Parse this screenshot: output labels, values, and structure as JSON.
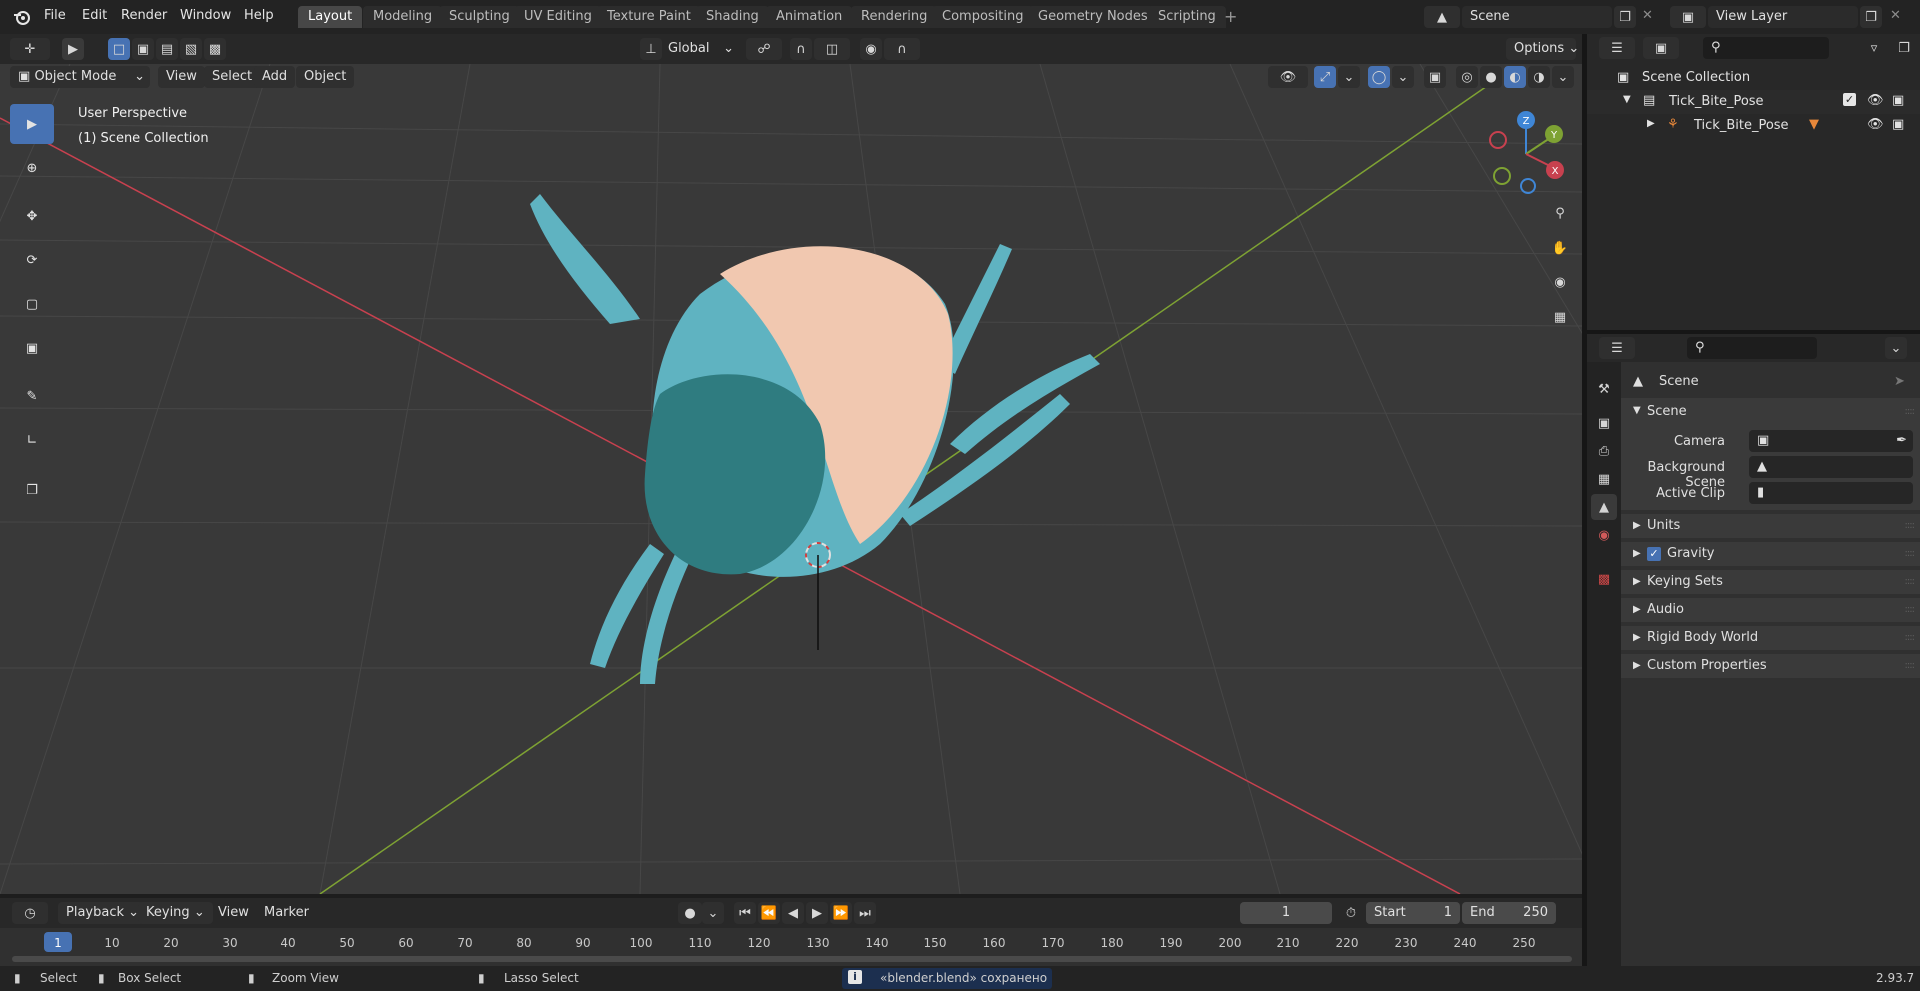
{
  "app": {
    "menu": [
      "File",
      "Edit",
      "Render",
      "Window",
      "Help"
    ],
    "workspaces": [
      "Layout",
      "Modeling",
      "Sculpting",
      "UV Editing",
      "Texture Paint",
      "Shading",
      "Animation",
      "Rendering",
      "Compositing",
      "Geometry Nodes",
      "Scripting"
    ],
    "active_workspace": "Layout",
    "scene_name": "Scene",
    "view_layer": "View Layer"
  },
  "viewport": {
    "mode": "Object Mode",
    "menus": [
      "View",
      "Select",
      "Add",
      "Object"
    ],
    "orientation": "Global",
    "options_label": "Options",
    "info_line1": "User Perspective",
    "info_line2": "(1) Scene Collection",
    "gizmo_axes": [
      "X",
      "Y",
      "Z"
    ],
    "colors": {
      "x_axis": "#c8414f",
      "y_axis": "#7ea233",
      "z_axis": "#3f86d6",
      "model_body": "#5fb3c1",
      "model_back": "#f1c8b0"
    }
  },
  "outliner": {
    "root": "Scene Collection",
    "items": [
      {
        "label": "Tick_Bite_Pose",
        "kind": "collection"
      },
      {
        "label": "Tick_Bite_Pose",
        "kind": "armature"
      }
    ]
  },
  "properties": {
    "context": "Scene",
    "section": "Scene",
    "fields": [
      {
        "label": "Camera",
        "value": ""
      },
      {
        "label": "Background Scene",
        "value": ""
      },
      {
        "label": "Active Clip",
        "value": ""
      }
    ],
    "panels": [
      "Units",
      "Gravity",
      "Keying Sets",
      "Audio",
      "Rigid Body World",
      "Custom Properties"
    ],
    "gravity_checked": true
  },
  "timeline": {
    "menus": [
      "Playback",
      "Keying",
      "View",
      "Marker"
    ],
    "current_frame": "1",
    "start_label": "Start",
    "start": "1",
    "end_label": "End",
    "end": "250",
    "ticks": [
      "1",
      "10",
      "20",
      "30",
      "40",
      "50",
      "60",
      "70",
      "80",
      "90",
      "100",
      "110",
      "120",
      "130",
      "140",
      "150",
      "160",
      "170",
      "180",
      "190",
      "200",
      "210",
      "220",
      "230",
      "240",
      "250"
    ]
  },
  "status": {
    "select": "Select",
    "box_select": "Box Select",
    "zoom_view": "Zoom View",
    "lasso_select": "Lasso Select",
    "message": "«blender.blend» сохранено",
    "version": "2.93.7"
  }
}
